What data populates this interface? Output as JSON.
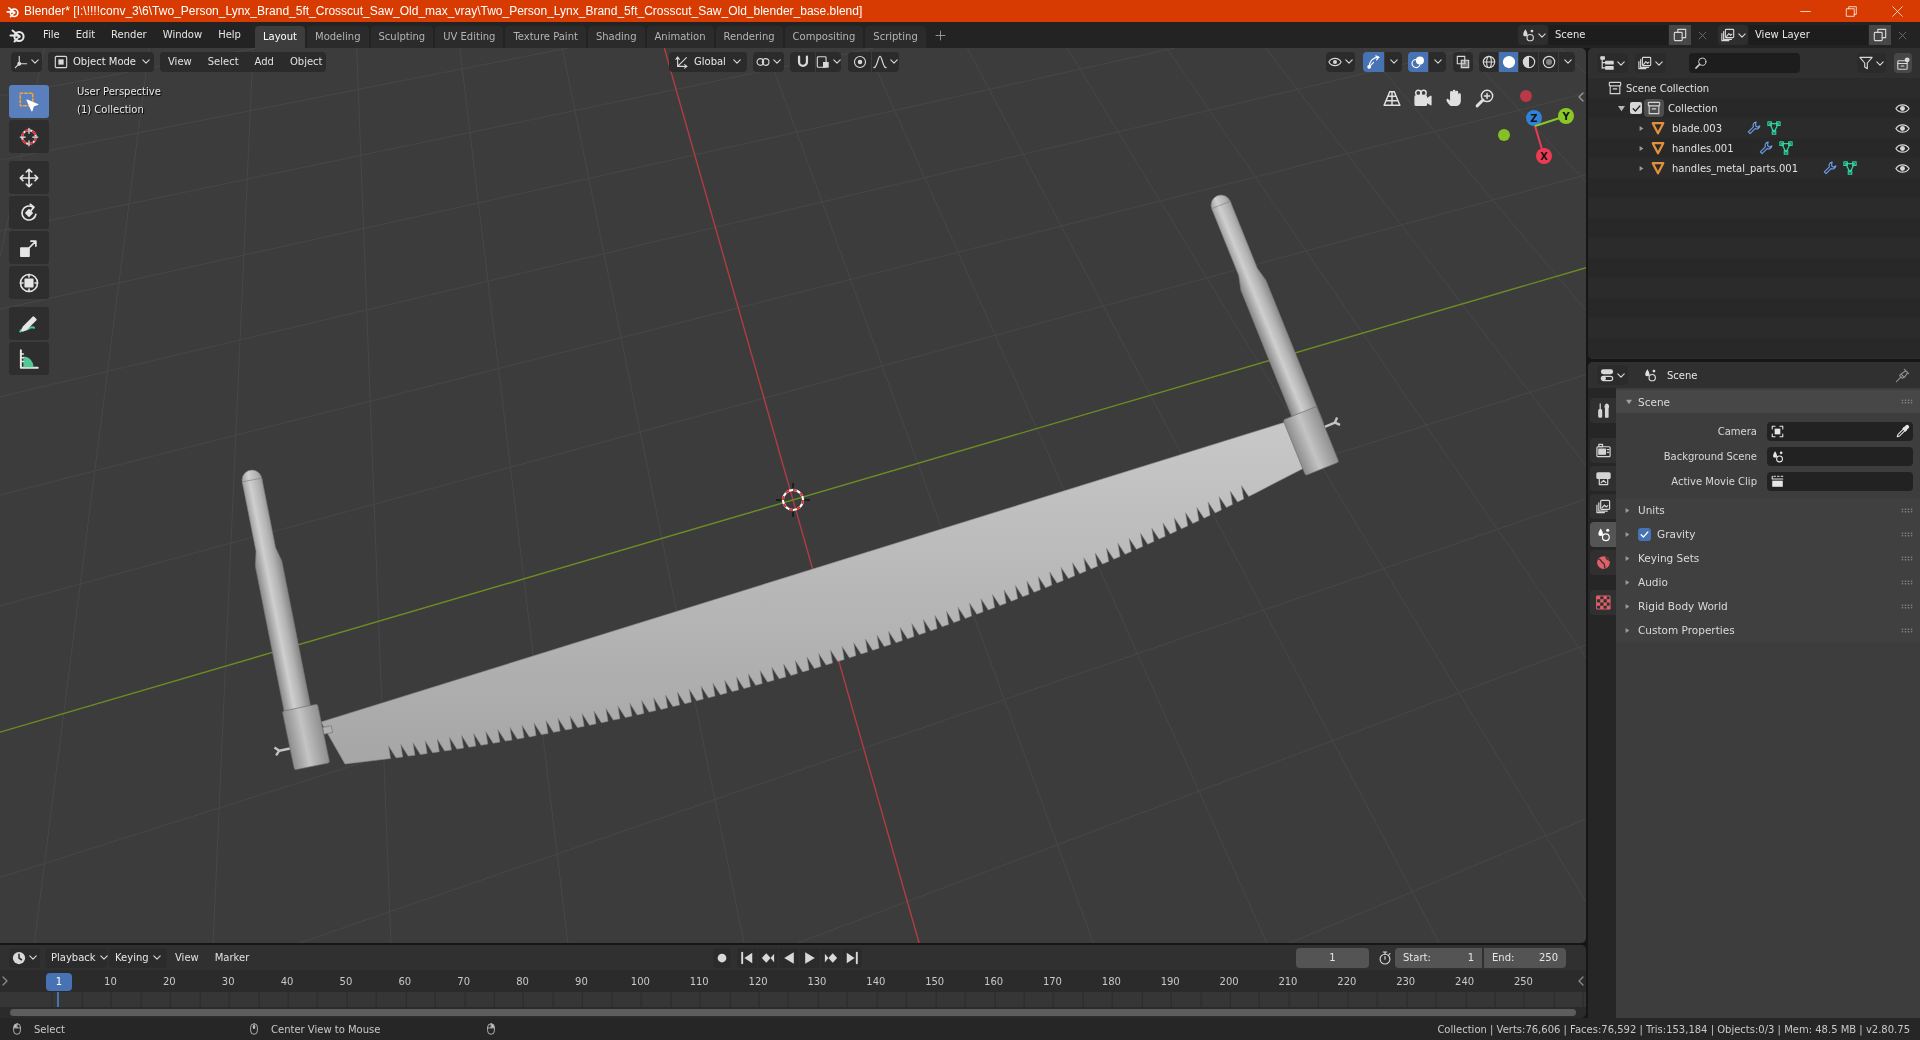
{
  "window": {
    "title": "Blender* [I:\\!!!!conv_3\\6\\Two_Person_Lynx_Brand_5ft_Crosscut_Saw_Old_max_vray\\Two_Person_Lynx_Brand_5ft_Crosscut_Saw_Old_blender_base.blend]"
  },
  "menu": [
    "File",
    "Edit",
    "Render",
    "Window",
    "Help"
  ],
  "workspaces": [
    {
      "label": "Layout",
      "selected": true
    },
    {
      "label": "Modeling",
      "selected": false
    },
    {
      "label": "Sculpting",
      "selected": false
    },
    {
      "label": "UV Editing",
      "selected": false
    },
    {
      "label": "Texture Paint",
      "selected": false
    },
    {
      "label": "Shading",
      "selected": false
    },
    {
      "label": "Animation",
      "selected": false
    },
    {
      "label": "Rendering",
      "selected": false
    },
    {
      "label": "Compositing",
      "selected": false
    },
    {
      "label": "Scripting",
      "selected": false
    }
  ],
  "scene_selector": {
    "value": "Scene"
  },
  "view_layer_selector": {
    "value": "View Layer"
  },
  "viewport": {
    "mode": "Object Mode",
    "menus": [
      "View",
      "Select",
      "Add",
      "Object"
    ],
    "orientation": "Global",
    "show_gizmos": true,
    "show_overlays": true,
    "xray": false,
    "shading": [
      {
        "kind": "wireframe",
        "selected": false
      },
      {
        "kind": "solid",
        "selected": true
      },
      {
        "kind": "material",
        "selected": false
      },
      {
        "kind": "rendered",
        "selected": false
      }
    ],
    "tools": [
      {
        "kind": "select_box",
        "selected": true
      },
      {
        "kind": "cursor",
        "selected": false
      },
      {
        "kind": "move",
        "selected": false
      },
      {
        "kind": "rotate",
        "selected": false
      },
      {
        "kind": "scale",
        "selected": false
      },
      {
        "kind": "transform",
        "selected": false
      },
      {
        "kind": "annotate",
        "selected": false
      },
      {
        "kind": "measure",
        "selected": false
      }
    ],
    "view_name": "User Perspective",
    "collection_label": "(1) Collection",
    "navigation_gizmo": [
      {
        "kind": "negative",
        "color": "#b83a48"
      },
      {
        "kind": "negative",
        "color": "#86c025"
      },
      {
        "kind": "positive",
        "label": "Z",
        "color": "#2f82d8"
      },
      {
        "kind": "positive",
        "label": "X",
        "color": "#ec3b52"
      },
      {
        "kind": "positive",
        "label": "Y",
        "color": "#8ac826"
      }
    ]
  },
  "outliner": {
    "items": [
      {
        "label": "Scene Collection",
        "kind": "scene_collection",
        "children": [
          {
            "label": "Collection",
            "kind": "collection",
            "expanded": true,
            "checked": true,
            "active": true,
            "visible": true,
            "children": [
              {
                "label": "blade.003",
                "kind": "mesh",
                "expanded": false,
                "visible": true
              },
              {
                "label": "handles.001",
                "kind": "mesh",
                "expanded": false,
                "visible": true
              },
              {
                "label": "handles_metal_parts.001",
                "kind": "mesh",
                "expanded": false,
                "visible": true
              }
            ]
          }
        ]
      }
    ]
  },
  "properties": {
    "context": "Scene",
    "tabs": [
      {
        "kind": "tool",
        "selected": false
      },
      {
        "kind": "render",
        "selected": false
      },
      {
        "kind": "output",
        "selected": false
      },
      {
        "kind": "view_layer",
        "selected": false
      },
      {
        "kind": "scene",
        "selected": true
      },
      {
        "kind": "world",
        "selected": false
      },
      {
        "kind": "texture",
        "selected": false
      }
    ],
    "panels": [
      {
        "title": "Scene",
        "expanded": true,
        "fields": [
          {
            "label": "Camera",
            "kind": "camera"
          },
          {
            "label": "Background Scene",
            "kind": "scene"
          },
          {
            "label": "Active Movie Clip",
            "kind": "clip"
          }
        ]
      },
      {
        "title": "Units",
        "expanded": false
      },
      {
        "title": "Gravity",
        "expanded": false,
        "checked": true
      },
      {
        "title": "Keying Sets",
        "expanded": false
      },
      {
        "title": "Audio",
        "expanded": false
      },
      {
        "title": "Rigid Body World",
        "expanded": false
      },
      {
        "title": "Custom Properties",
        "expanded": false
      }
    ]
  },
  "timeline": {
    "menus": [
      {
        "label": "Playback",
        "kind": "dropdown"
      },
      {
        "label": "Keying",
        "kind": "dropdown"
      },
      {
        "label": "View",
        "kind": "menu"
      },
      {
        "label": "Marker",
        "kind": "menu"
      }
    ],
    "current_frame": "1",
    "start_label": "Start:",
    "start": "1",
    "end_label": "End:",
    "end": "250",
    "playhead": "1",
    "ruler": [
      "10",
      "20",
      "30",
      "40",
      "50",
      "60",
      "70",
      "80",
      "90",
      "100",
      "110",
      "120",
      "130",
      "140",
      "150",
      "160",
      "170",
      "180",
      "190",
      "200",
      "210",
      "220",
      "230",
      "240",
      "250"
    ]
  },
  "status_bar": {
    "hints": [
      {
        "kind": "left_mouse",
        "label": "Select"
      },
      {
        "kind": "middle_mouse",
        "label": "Center View to Mouse"
      },
      {
        "kind": "right_mouse"
      }
    ],
    "stats": "Collection | Verts:76,606 | Faces:76,592 | Tris:153,184 | Objects:0/3 | Mem: 48.5 MB | v2.80.75"
  }
}
